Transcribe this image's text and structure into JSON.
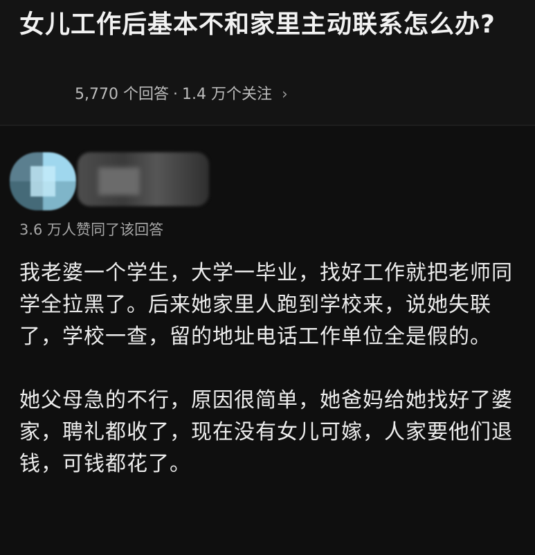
{
  "question": {
    "title": "女儿工作后基本不和家里主动联系怎么办?",
    "answers_count": "5,770 个回答",
    "separator": "·",
    "followers_count": "1.4 万个关注",
    "chevron": "›"
  },
  "answer": {
    "likes_text": "3.6 万人赞同了该回答",
    "paragraphs": [
      "我老婆一个学生，大学一毕业，找好工作就把老师同学全拉黑了。后来她家里人跑到学校来，说她失联了，学校一查，留的地址电话工作单位全是假的。",
      "她父母急的不行，原因很简单，她爸妈给她找好了婆家，聘礼都收了，现在没有女儿可嫁，人家要他们退钱，可钱都花了。"
    ]
  },
  "colors": {
    "background": "#111111",
    "title": "#f2f2f2",
    "meta": "#bdbdbd",
    "body_text": "#ededed",
    "muted": "#a8a8a8"
  },
  "icons": {
    "chevron": "chevron-right-icon"
  }
}
